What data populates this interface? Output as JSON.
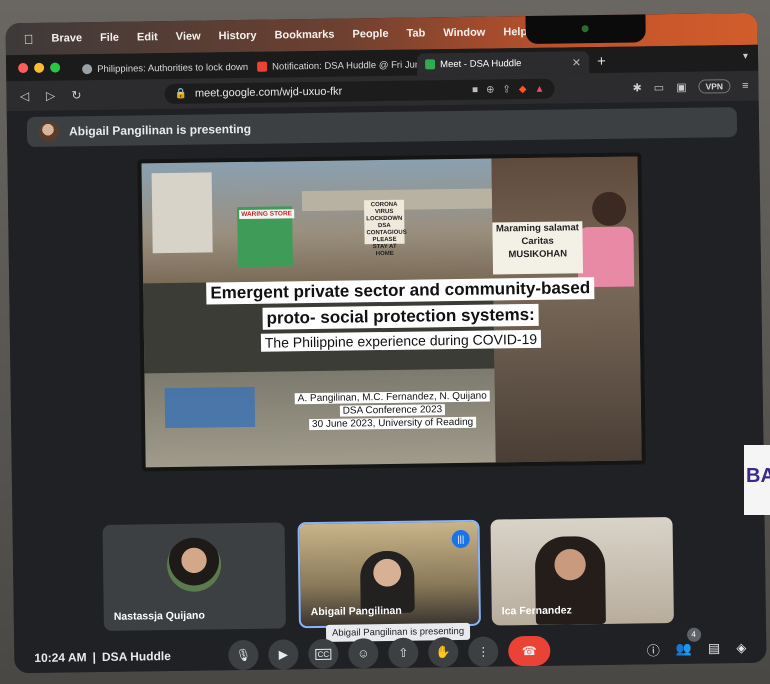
{
  "menubar": {
    "items": [
      "Brave",
      "File",
      "Edit",
      "View",
      "History",
      "Bookmarks",
      "People",
      "Tab",
      "Window",
      "Help"
    ]
  },
  "tabs": [
    {
      "label": "Philippines: Authorities to lock down",
      "favicon_color": "#9aa0a6"
    },
    {
      "label": "Notification: DSA Huddle @ Fri Jun",
      "favicon_color": "#ea4335"
    },
    {
      "label": "Meet - DSA Huddle",
      "favicon_color": "#34a853"
    }
  ],
  "toolbar": {
    "url": "meet.google.com/wjd-uxuo-fkr",
    "vpn_label": "VPN"
  },
  "meet": {
    "presenting_banner": "Abigail Pangilinan is presenting",
    "slide": {
      "title_line1": "Emergent private sector and community-based",
      "title_line2": "proto- social protection systems:",
      "subtitle": "The Philippine experience during COVID-19",
      "authors": "A. Pangilinan, M.C. Fernandez, N. Quijano",
      "conference": "DSA Conference 2023",
      "date_place": "30 June 2023, University of Reading",
      "sign_left": "CORONA VIRUS LOCKDOWN DSA CONTAGIOUS PLEASE STAY AT HOME",
      "sign_right": "Maraming salamat Caritas MUSIKOHAN",
      "store_sign": "WARING STORE"
    },
    "participants": [
      {
        "name": "Nastassja Quijano"
      },
      {
        "name": "Abigail Pangilinan"
      },
      {
        "name": "Ica Fernandez"
      }
    ],
    "tooltip": "Abigail Pangilinan is presenting",
    "time": "10:24 AM",
    "separator": "|",
    "meeting_name": "DSA Huddle",
    "people_count": "4"
  },
  "edge_text": "BA"
}
